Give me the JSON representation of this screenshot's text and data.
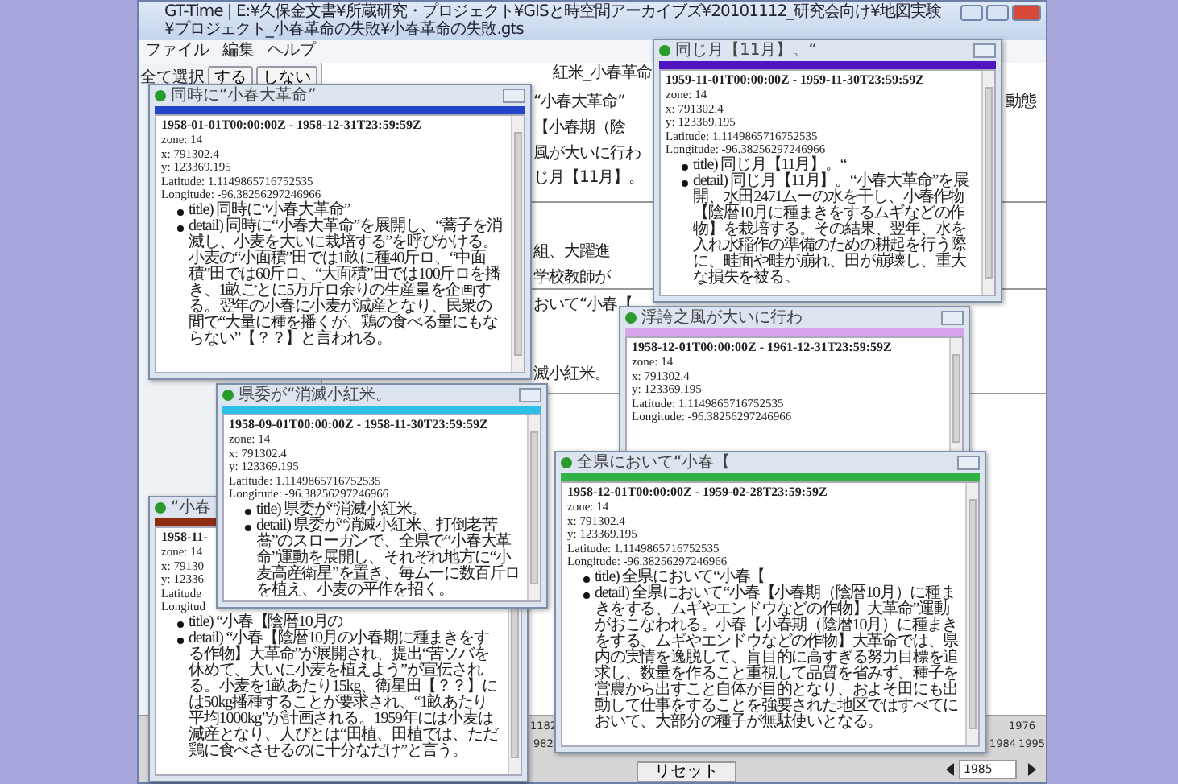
{
  "app_window": {
    "title": "GT-Time | E:¥久保金文書¥所蔵研究・プロジェクト¥GISと時空間アーカイブズ¥20101112_研究会向け¥地図実験¥プロジェクト_小春革命の失敗¥小春革命の失敗.gts",
    "menu": [
      "ファイル",
      "編集",
      "ヘルプ"
    ],
    "toolbar": {
      "label": "全て選択",
      "buttons": [
        "する",
        "しない"
      ]
    },
    "background_texts": [
      "紅米_小春革命",
      "“小春大革命”",
      "動態",
      "【小春期（陰",
      "風が大いに行わ",
      "じ月【11月】。",
      "組、大躍進",
      "学校教師が",
      "おいて“小春【",
      "滅小紅米。"
    ],
    "timeline": {
      "labels": [
        "1182",
        "1976",
        "982",
        "1984",
        "1995"
      ],
      "reset_button": "リセット",
      "year_field": "1985"
    }
  },
  "popups": [
    {
      "title": "同時に“小春大革命”",
      "color": "#2343c8",
      "period": "1958-01-01T00:00:00Z - 1958-12-31T23:59:59Z",
      "fields": [
        "zone: 14",
        "x: 791302.4",
        "y: 123369.195",
        "Latitude: 1.1149865716752535",
        "Longitude: -96.38256297246966"
      ],
      "items": [
        "title) 同時に“小春大革命”",
        "detail) 同時に“小春大革命”を展開し、“蕎子を消滅し、小麦を大いに栽培する”を呼びかける。小麦の“小面積”田では1畝に種40斤ロ、“中面積”田では60斤ロ、“大面積”田では100斤ロを播き、1畝ごとに5万斤ロ余りの生産量を企画する。翌年の小春に小麦が減産となり、民衆の間で“大量に種を播くが、鶏の食べる量にもならない”【？？】と言われる。"
      ]
    },
    {
      "title": "同じ月【11月】。“",
      "color": "#5014c0",
      "period": "1959-11-01T00:00:00Z - 1959-11-30T23:59:59Z",
      "fields": [
        "zone: 14",
        "x: 791302.4",
        "y: 123369.195",
        "Latitude: 1.1149865716752535",
        "Longitude: -96.38256297246966"
      ],
      "items": [
        "title) 同じ月【11月】。“",
        "detail) 同じ月【11月】。“小春大革命”を展開、水田2471ムーの水を干し、小春作物【陰暦10月に種まきをするムギなどの作物】を栽培する。その結果、翌年、水を入れ水稲作の準備のための耕起を行う際に、畦面や畦が崩れ、田が崩壊し、重大な損失を被る。"
      ]
    },
    {
      "title": "浮誇之風が大いに行わ",
      "color": "#d8a4ea",
      "period": "1958-12-01T00:00:00Z - 1961-12-31T23:59:59Z",
      "fields": [
        "zone: 14",
        "x: 791302.4",
        "y: 123369.195",
        "Latitude: 1.1149865716752535",
        "Longitude: -96.38256297246966"
      ]
    },
    {
      "title": "県委が“消滅小紅米。",
      "color": "#2cc0e4",
      "period": "1958-09-01T00:00:00Z - 1958-11-30T23:59:59Z",
      "fields": [
        "zone: 14",
        "x: 791302.4",
        "y: 123369.195",
        "Latitude: 1.1149865716752535",
        "Longitude: -96.38256297246966"
      ],
      "items": [
        "title) 県委が“消滅小紅米。",
        "detail) 県委が“消滅小紅米、打倒老苦蕎”のスローガンで、全県で“小春大革命”運動を展開し、それぞれ地方に“小麦高産衛星”を置き、毎ムーに数百斤ロを植え、小麦の平作を招く。"
      ]
    },
    {
      "title": "“小春",
      "color": "#8c2c10",
      "period": "1958-11-",
      "fields": [
        "zone: 14",
        "x: 79130",
        "y: 12336",
        "Latitude",
        "Longitud"
      ],
      "items": [
        "title) “小春【陰暦10月の",
        "detail) “小春【陰暦10月の小春期に種まきをする作物】大革命”が展開され、提出“苦ソバを休めて、大いに小麦を植えよう”が宣伝される。小麦を1畝あたり15kg、衛星田【？？】には50kg播種することが要求され、“1畝あたり平均1000kg”が計画される。1959年には小麦は減産となり、人びとは“田植、田植では、ただ鶏に食べさせるのに十分なだけ”と言う。"
      ]
    },
    {
      "title": "全県において“小春【",
      "color": "#30b244",
      "period": "1958-12-01T00:00:00Z - 1959-02-28T23:59:59Z",
      "fields": [
        "zone: 14",
        "x: 791302.4",
        "y: 123369.195",
        "Latitude: 1.1149865716752535",
        "Longitude: -96.38256297246966"
      ],
      "items": [
        "title) 全県において“小春【",
        "detail) 全県において“小春【小春期（陰暦10月）に種まきをする、ムギやエンドウなどの作物】大革命”運動がおこなわれる。小春【小春期（陰暦10月）に種まきをする、ムギやエンドウなどの作物】大革命では、県内の実情を逸脱して、盲目的に高すぎる努力目標を追求し、数量を作ること重視して品質を省みず、種子を営農から出すこと自体が目的となり、およそ田にも出動して仕事をすることを強要された地区ではすべてにおいて、大部分の種子が無駄使いとなる。"
      ]
    }
  ]
}
